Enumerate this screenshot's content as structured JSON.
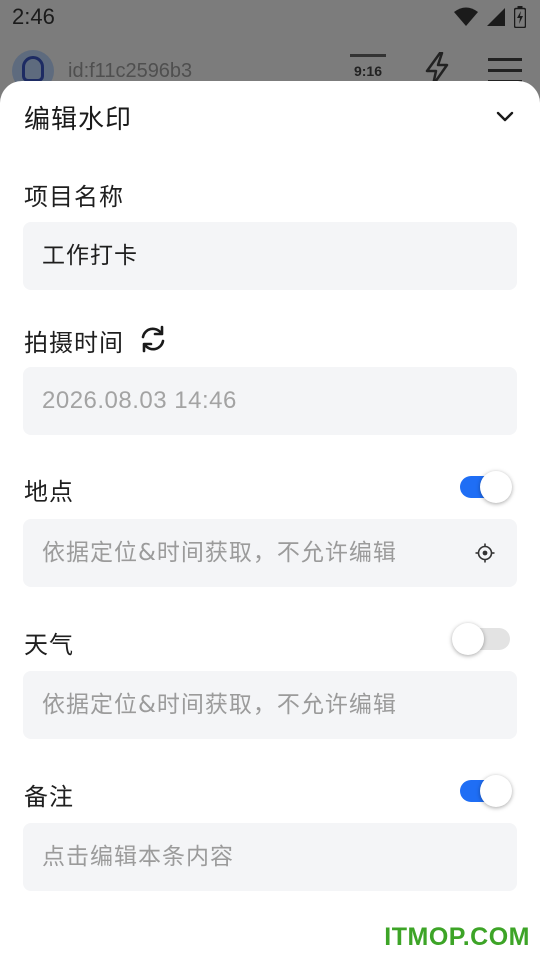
{
  "status_bar": {
    "time": "2:46",
    "icons": [
      "wifi-icon",
      "signal-icon",
      "battery-icon"
    ]
  },
  "background_header": {
    "user_id": "id:f11c2596b3",
    "clock_icon_text": "9:16",
    "icons": [
      "avatar",
      "clock-template-icon",
      "flash-icon",
      "menu-icon"
    ]
  },
  "sheet": {
    "title": "编辑水印",
    "sections": {
      "project": {
        "label": "项目名称",
        "value": "工作打卡"
      },
      "capture_time": {
        "label": "拍摄时间",
        "value": "2026.08.03 14:46"
      },
      "location": {
        "label": "地点",
        "placeholder": "依据定位&时间获取，不允许编辑",
        "enabled": true
      },
      "weather": {
        "label": "天气",
        "placeholder": "依据定位&时间获取，不允许编辑",
        "enabled": false
      },
      "remark": {
        "label": "备注",
        "placeholder": "点击编辑本条内容",
        "enabled": true
      }
    }
  },
  "watermark": "ITMOP.COM",
  "colors": {
    "accent": "#1f6ef5",
    "field_bg": "#f4f5f7",
    "hint_text": "#9b9b9b",
    "watermark": "#3da427"
  }
}
